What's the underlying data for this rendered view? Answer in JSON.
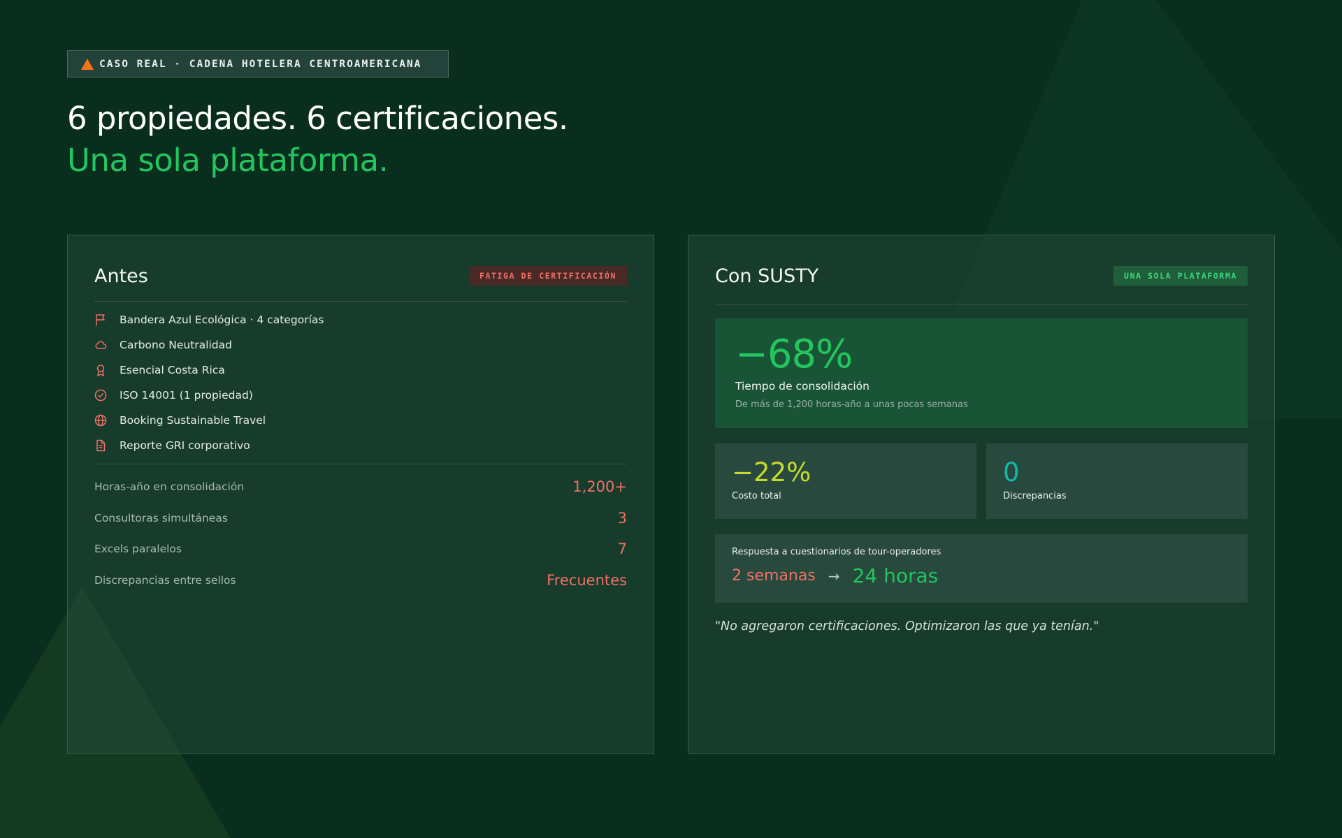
{
  "tag": {
    "icon": "warning-triangle-icon",
    "label": "CASO REAL · CADENA HOTELERA CENTROAMERICANA"
  },
  "headline": {
    "line1": "6 propiedades. 6 certificaciones.",
    "line2": "Una sola plataforma."
  },
  "before": {
    "title": "Antes",
    "badge": "FATIGA DE CERTIFICACIÓN",
    "certifications": [
      {
        "icon": "flag-icon",
        "label": "Bandera Azul Ecológica · 4 categorías"
      },
      {
        "icon": "cloud-icon",
        "label": "Carbono Neutralidad"
      },
      {
        "icon": "award-icon",
        "label": "Esencial Costa Rica"
      },
      {
        "icon": "check-circle-icon",
        "label": "ISO 14001 (1 propiedad)"
      },
      {
        "icon": "globe-icon",
        "label": "Booking Sustainable Travel"
      },
      {
        "icon": "document-icon",
        "label": "Reporte GRI corporativo"
      }
    ],
    "stats": [
      {
        "label": "Horas-año en consolidación",
        "value": "1,200+"
      },
      {
        "label": "Consultoras simultáneas",
        "value": "3"
      },
      {
        "label": "Excels paralelos",
        "value": "7"
      },
      {
        "label": "Discrepancias entre sellos",
        "value": "Frecuentes"
      }
    ]
  },
  "after": {
    "title": "Con SUSTY",
    "badge": "UNA SOLA PLATAFORMA",
    "highlight": {
      "value": "−68%",
      "label": "Tiempo de consolidación",
      "sub": "De más de 1,200 horas-año a unas pocas semanas"
    },
    "cost": {
      "value": "−22%",
      "label": "Costo total"
    },
    "discrepancies": {
      "value": "0",
      "label": "Discrepancias"
    },
    "response": {
      "label": "Respuesta a cuestionarios de tour-operadores",
      "from": "2 semanas",
      "arrow": "→",
      "to": "24 horas"
    },
    "quote": "\"No agregaron certificaciones. Optimizaron las que ya tenían.\""
  },
  "colors": {
    "background": "#0a2e1e",
    "accent_green": "#22c55e",
    "accent_red": "#f07066",
    "accent_yellow": "#c9d92e",
    "accent_teal": "#14b8a6",
    "warning_orange": "#f97316"
  }
}
